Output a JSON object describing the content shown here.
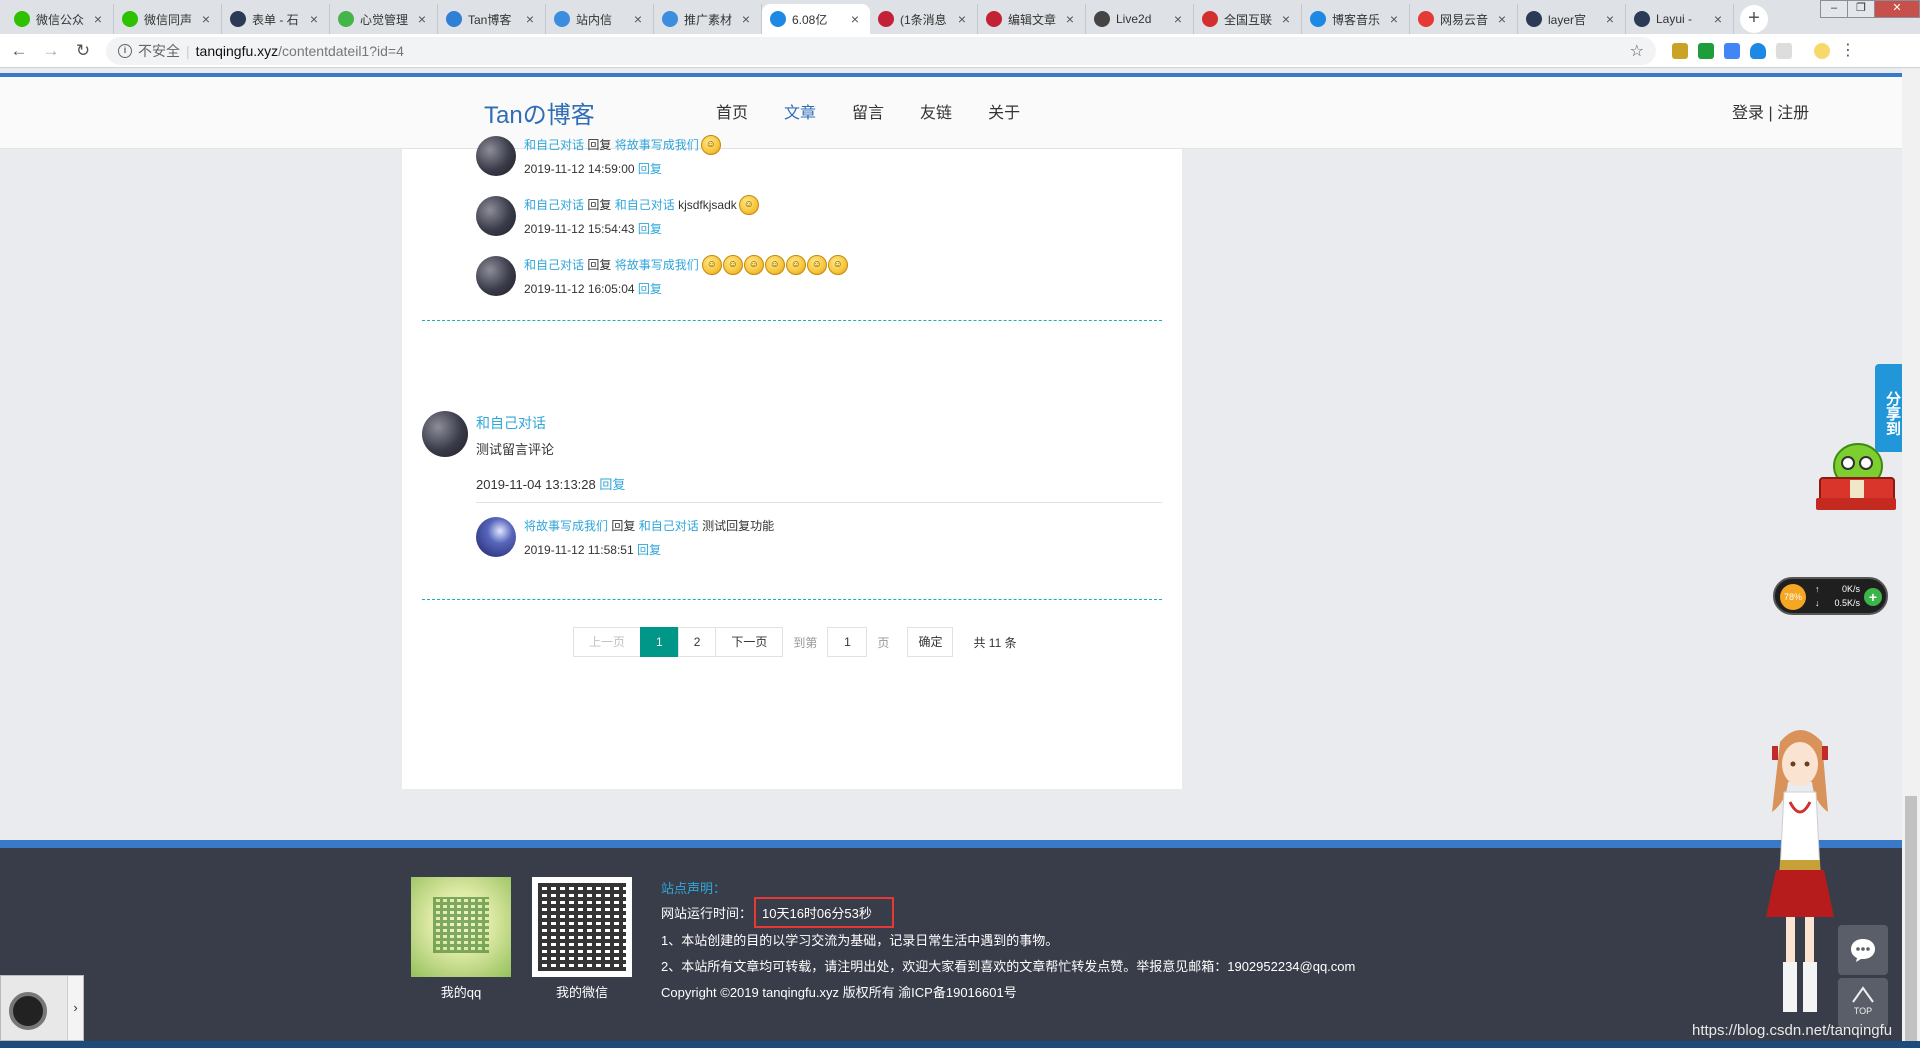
{
  "browser": {
    "tabs": [
      {
        "label": "微信公众",
        "color": "#2dc100"
      },
      {
        "label": "微信同声",
        "color": "#2dc100"
      },
      {
        "label": "表单 - 石",
        "color": "#2b3a55"
      },
      {
        "label": "心觉管理",
        "color": "#44b549"
      },
      {
        "label": "Tan博客",
        "color": "#2f7fd6"
      },
      {
        "label": "站内信",
        "color": "#3c8de0"
      },
      {
        "label": "推广素材",
        "color": "#3c8de0"
      },
      {
        "label": "6.08亿",
        "color": "#1e88e5",
        "active": true
      },
      {
        "label": "(1条消息",
        "color": "#c32136"
      },
      {
        "label": "编辑文章",
        "color": "#c32136"
      },
      {
        "label": "Live2d",
        "color": "#444444"
      },
      {
        "label": "全国互联",
        "color": "#d32f2f"
      },
      {
        "label": "博客音乐",
        "color": "#1e88e5"
      },
      {
        "label": "网易云音",
        "color": "#e53935"
      },
      {
        "label": "layer官",
        "color": "#2b3a55"
      },
      {
        "label": "Layui -",
        "color": "#2b3a55"
      }
    ],
    "address": {
      "insecure_label": "不安全",
      "host": "tanqingfu.xyz",
      "path": "/contentdateil1?id=4"
    }
  },
  "site": {
    "logo": "Tanの博客",
    "nav": [
      {
        "label": "首页",
        "active": false
      },
      {
        "label": "文章",
        "active": true
      },
      {
        "label": "留言",
        "active": false
      },
      {
        "label": "友链",
        "active": false
      },
      {
        "label": "关于",
        "active": false
      }
    ],
    "auth": {
      "login": "登录",
      "sep": "|",
      "register": "注册"
    }
  },
  "replies_top": [
    {
      "from": "和自己对话",
      "verb": "回复",
      "to": "将故事写成我们",
      "text": "",
      "time": "2019-11-12 14:59:00",
      "action": "回复",
      "emojis": 1
    },
    {
      "from": "和自己对话",
      "verb": "回复",
      "to": "和自己对话",
      "text": "kjsdfkjsadk",
      "time": "2019-11-12 15:54:43",
      "action": "回复",
      "emojis": 1
    },
    {
      "from": "和自己对话",
      "verb": "回复",
      "to": "将故事写成我们",
      "text": "",
      "time": "2019-11-12 16:05:04",
      "action": "回复",
      "emojis": 7
    }
  ],
  "comment": {
    "author": "和自己对话",
    "body": "测试留言评论",
    "time": "2019-11-04 13:13:28",
    "action": "回复"
  },
  "reply_bottom": {
    "from": "将故事写成我们",
    "verb": "回复",
    "to": "和自己对话",
    "text": "测试回复功能",
    "time": "2019-11-12 11:58:51",
    "action": "回复"
  },
  "pager": {
    "prev": "上一页",
    "pages": [
      "1",
      "2"
    ],
    "current": "1",
    "next": "下一页",
    "goto_label": "到第",
    "goto_value": "1",
    "page_unit": "页",
    "confirm": "确定",
    "total": "共 11 条"
  },
  "footer": {
    "qr_labels": [
      "我的qq",
      "我的微信"
    ],
    "statement_title": "站点声明：",
    "runtime_label": "网站运行时间：",
    "runtime_value": "10天16时06分53秒",
    "notice1": "1、本站创建的目的以学习交流为基础，记录日常生活中遇到的事物。",
    "notice2": "2、本站所有文章均可转载，请注明出处，欢迎大家看到喜欢的文章帮忙转发点赞。举报意见邮箱：1902952234@qq.com",
    "copyright": "Copyright ©2019 tanqingfu.xyz 版权所有 渝ICP备19016601号"
  },
  "widgets": {
    "share": "分享到",
    "speed_pct": "78%",
    "speed_up": "0K/s",
    "speed_down": "0.5K/s",
    "top_label": "TOP",
    "watermark": "https://blog.csdn.net/tanqingfu"
  }
}
